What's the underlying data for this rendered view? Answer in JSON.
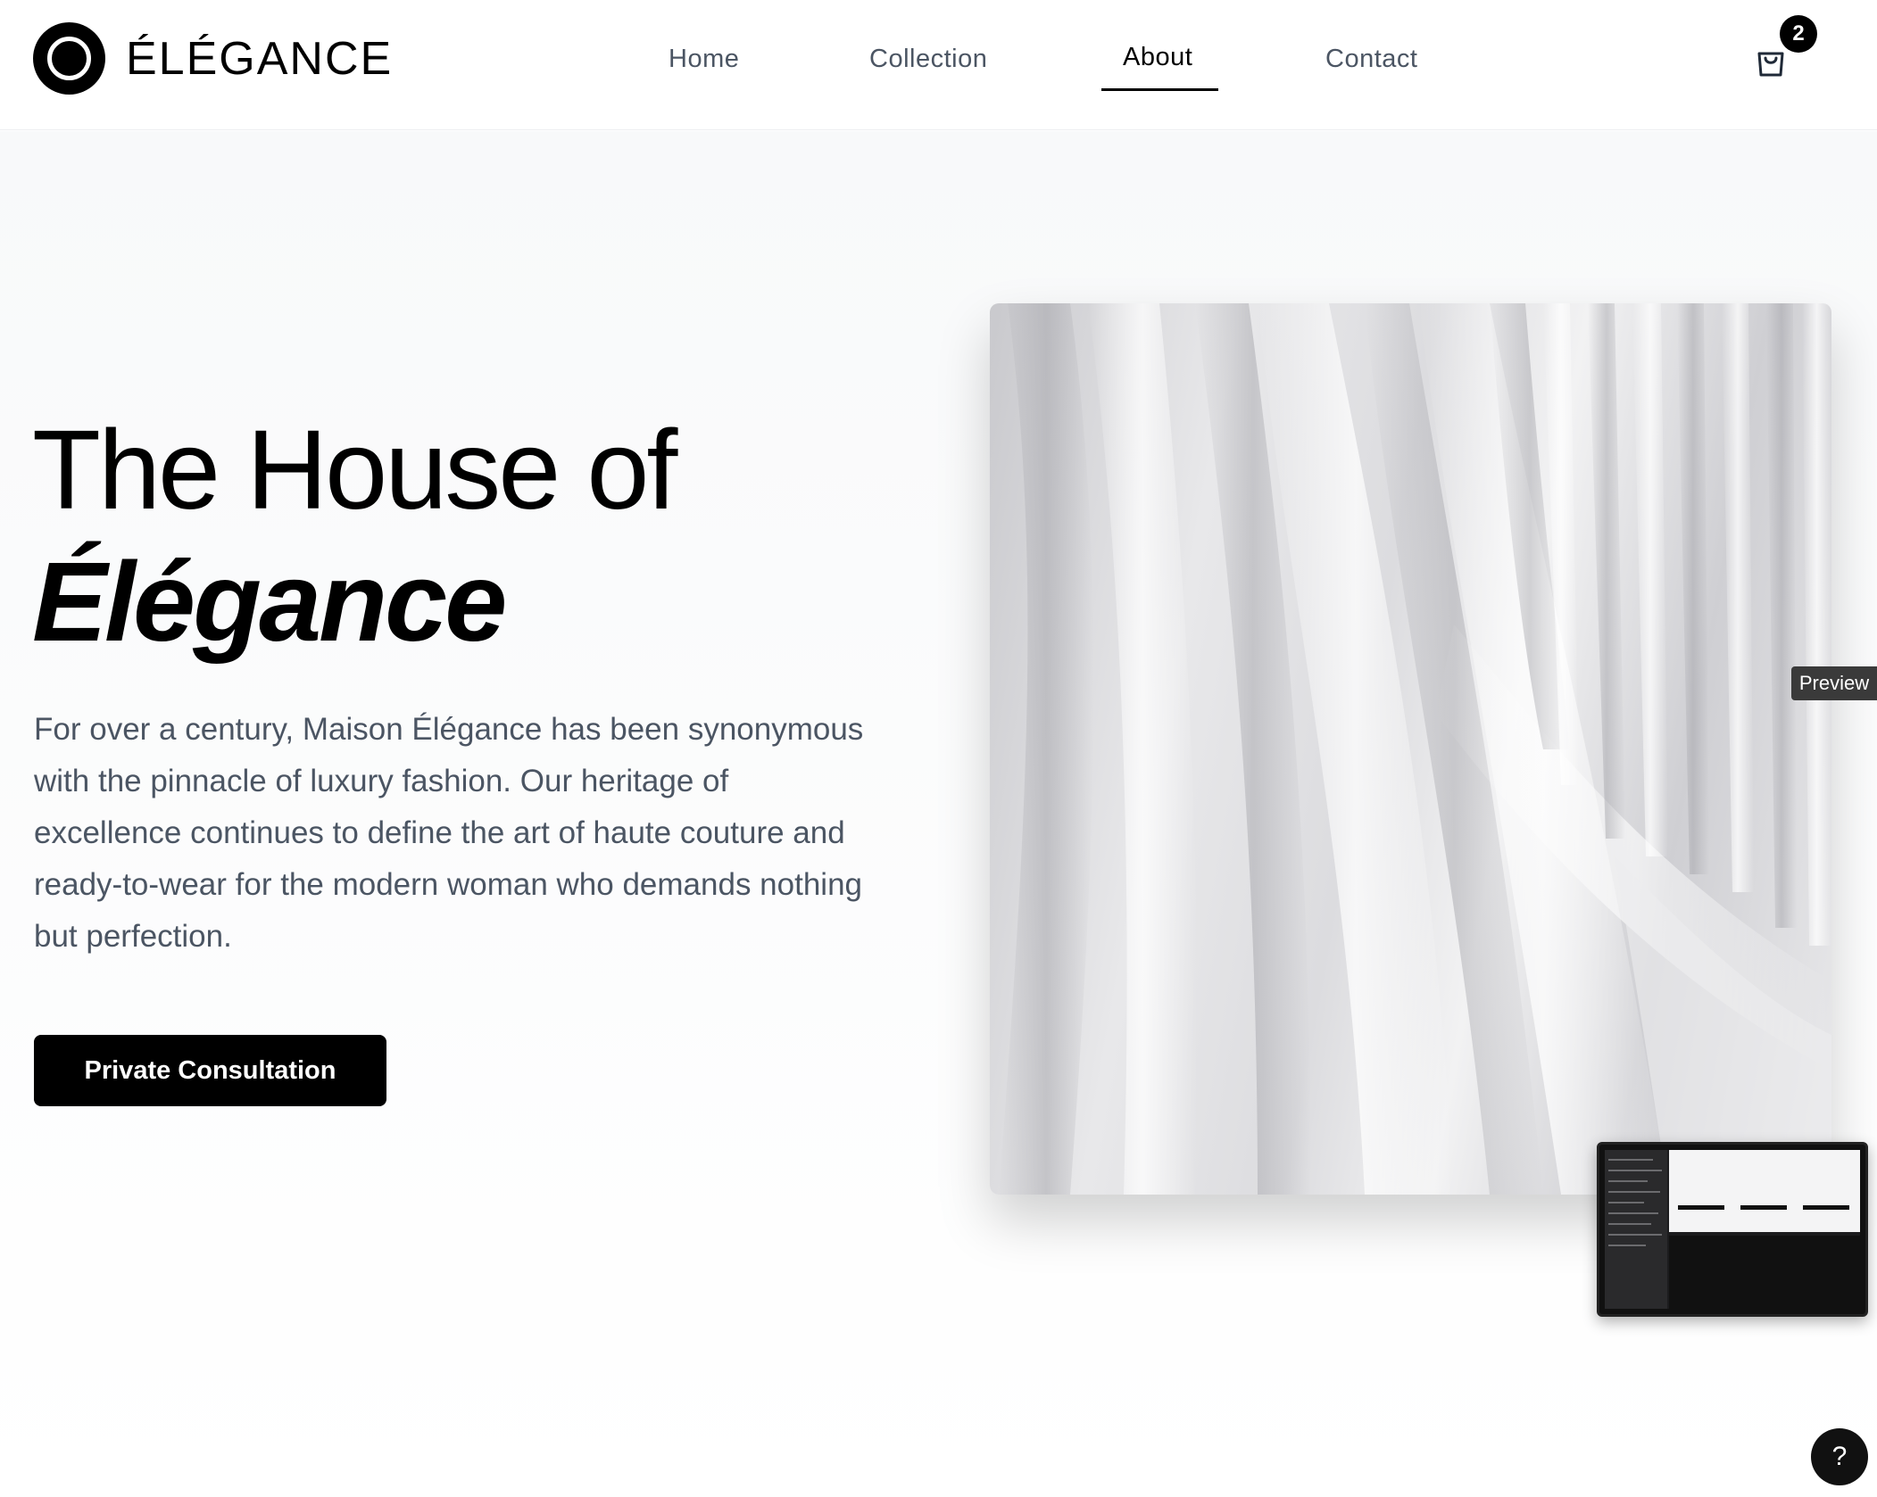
{
  "brand": {
    "name": "ÉLÉGANCE"
  },
  "nav": {
    "items": [
      {
        "label": "Home"
      },
      {
        "label": "Collection"
      },
      {
        "label": "About"
      },
      {
        "label": "Contact"
      }
    ],
    "active": "About"
  },
  "cart": {
    "count": "2",
    "icon": "shopping-bag-icon"
  },
  "hero": {
    "title_line1": "The House of",
    "title_line2": "Élégance",
    "description": "For over a century, Maison Élégance has been synonymous with the pinnacle of luxury fashion. Our heritage of excellence continues to define the art of haute couture and ready-to-wear for the modern woman who demands nothing but perfection.",
    "cta_label": "Private Consultation"
  },
  "preview": {
    "label": "Preview"
  },
  "help": {
    "label": "?"
  },
  "colors": {
    "accent": "#000000",
    "nav_text": "#4b5563",
    "body_text": "#4b5563",
    "background": "#f8f9fa"
  }
}
